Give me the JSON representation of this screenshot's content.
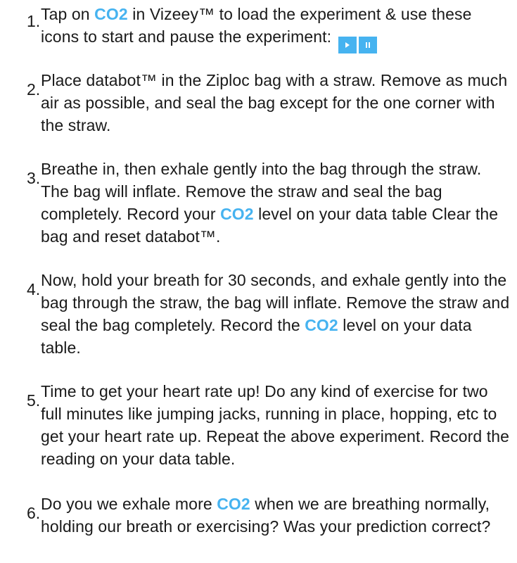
{
  "steps": [
    {
      "number": "1.",
      "parts": [
        {
          "t": "Tap on "
        },
        {
          "t": "CO2",
          "hl": true
        },
        {
          "t": " in Vizeey™ to load the experiment & use these icons to start and pause the experiment:"
        }
      ],
      "controls": [
        {
          "name": "play-button",
          "icon": "play-icon"
        },
        {
          "name": "pause-button",
          "icon": "pause-icon"
        }
      ]
    },
    {
      "number": "2.",
      "parts": [
        {
          "t": "Place databot™ in the Ziploc bag with a straw.  Remove as much air as possible, and seal the bag except for the one corner with the straw."
        }
      ]
    },
    {
      "number": "3.",
      "parts": [
        {
          "t": "Breathe in, then exhale gently into the bag through the straw. The bag will inflate. Remove the straw and seal the bag completely. Record your "
        },
        {
          "t": "CO2",
          "hl": true
        },
        {
          "t": " level on your data table Clear the bag and reset databot™."
        }
      ]
    },
    {
      "number": "4.",
      "parts": [
        {
          "t": "Now, hold your breath for 30 seconds, and exhale gently into the bag through the straw, the bag will inflate. Remove the straw and seal the bag completely. Record the "
        },
        {
          "t": "CO2",
          "hl": true
        },
        {
          "t": " level on your data table."
        }
      ]
    },
    {
      "number": "5.",
      "parts": [
        {
          "t": "Time to get your heart rate up!  Do any kind of exercise for two full minutes like jumping jacks, running in place, hopping, etc to get your heart rate up. Repeat the above experiment. Record the reading on your data table."
        }
      ]
    },
    {
      "number": "6.",
      "parts": [
        {
          "t": "Do you we exhale more "
        },
        {
          "t": "CO2",
          "hl": true
        },
        {
          "t": " when we are breathing normally, holding our breath or exercising?  Was your prediction correct?"
        }
      ]
    }
  ],
  "colors": {
    "highlight": "#46b3f0",
    "text": "#1a1a1a",
    "control_button": "#46b3f0"
  }
}
